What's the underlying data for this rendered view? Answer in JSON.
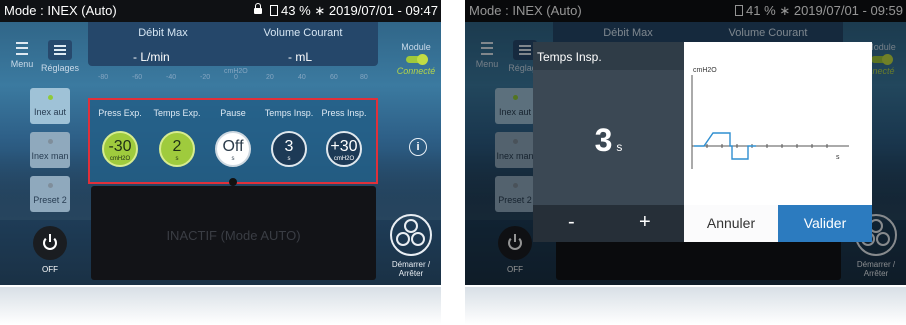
{
  "left": {
    "status": {
      "mode": "Mode : INEX (Auto)",
      "battery": "43 %",
      "datetime": "2019/07/01 - 09:47",
      "bluetooth": "∗"
    },
    "header": {
      "debit_label": "Débit Max",
      "debit_value": "- L/min",
      "volume_label": "Volume Courant",
      "volume_value": "- mL"
    },
    "scale": {
      "unit": "cmH2O",
      "ticks": [
        "-80",
        "-60",
        "-40",
        "-20",
        "0",
        "20",
        "40",
        "60",
        "80"
      ]
    },
    "menu_label": "Menu",
    "reglages_label": "Réglages",
    "module": {
      "label": "Module",
      "status": "Connecté"
    },
    "side_buttons": [
      {
        "label": "Inex aut",
        "dot_color": "#8fca3a"
      },
      {
        "label": "Inex man",
        "dot_color": "#7f8e9b"
      },
      {
        "label": "Preset 2",
        "dot_color": "#7f8e9b"
      }
    ],
    "power_label": "OFF",
    "controls": {
      "labels": [
        "Press Exp.",
        "Temps Exp.",
        "Pause",
        "Temps Insp.",
        "Press Insp."
      ],
      "knobs": [
        {
          "value": "-30",
          "unit": "cmH2O"
        },
        {
          "value": "2",
          "unit": "s"
        },
        {
          "value": "Off",
          "unit": "s"
        },
        {
          "value": "3",
          "unit": "s"
        },
        {
          "value": "+30",
          "unit": "cmH2O"
        }
      ]
    },
    "inactive_text": "INACTIF (Mode AUTO)",
    "start_stop_label": "Démarrer / Arrêter"
  },
  "right": {
    "status": {
      "mode": "Mode : INEX (Auto)",
      "battery": "41 %",
      "datetime": "2019/07/01 - 09:59",
      "bluetooth": "∗"
    },
    "header": {
      "debit_label": "Débit Max",
      "volume_label": "Volume Courant"
    },
    "menu_label": "Menu",
    "reglages_label": "Réglage",
    "module_label": "Module",
    "module_status": "nnecté",
    "side_buttons": [
      "Inex aut",
      "Inex man",
      "Preset 2"
    ],
    "power_label": "OFF",
    "start_stop_label": "Démarrer / Arrêter",
    "dialog": {
      "title": "Temps Insp.",
      "value": "3",
      "unit": "s",
      "graph_unit": "cmH2O",
      "graph_tick": "s",
      "minus": "-",
      "plus": "+",
      "cancel": "Annuler",
      "validate": "Valider"
    }
  },
  "colors": {
    "accent_green": "#9fcb3d",
    "validate_blue": "#2c7bbf",
    "highlight_red": "#e0303a"
  }
}
